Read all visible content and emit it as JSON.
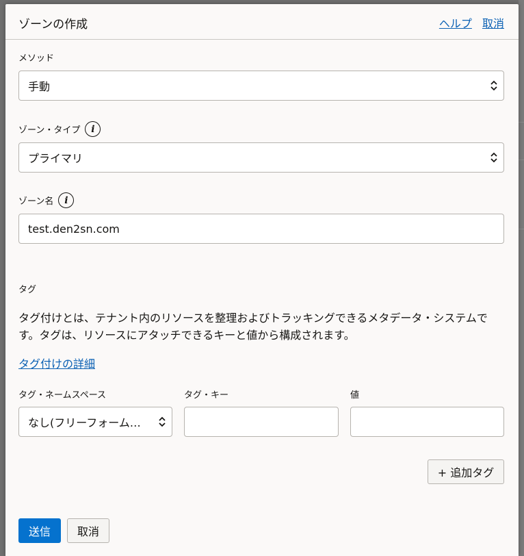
{
  "header": {
    "title": "ゾーンの作成",
    "help_link": "ヘルプ",
    "cancel_link": "取消"
  },
  "method": {
    "label": "メソッド",
    "selected": "手動"
  },
  "zone_type": {
    "label": "ゾーン・タイプ",
    "selected": "プライマリ"
  },
  "zone_name": {
    "label": "ゾーン名",
    "value": "test.den2sn.com"
  },
  "tags": {
    "section_label": "タグ",
    "description": "タグ付けとは、テナント内のリソースを整理およびトラッキングできるメタデータ・システムです。タグは、リソースにアタッチできるキーと値から構成されます。",
    "details_link": "タグ付けの詳細",
    "namespace_label": "タグ・ネームスペース",
    "namespace_selected": "なし(フリーフォーム…",
    "key_label": "タグ・キー",
    "key_value": "",
    "value_label": "値",
    "value_value": "",
    "add_tag_button": "+ 追加タグ"
  },
  "footer": {
    "submit_button": "送信",
    "cancel_button": "取消"
  },
  "colors": {
    "accent": "#0572ce",
    "link": "#0b61b4",
    "panel_bg": "#fbf9f8"
  }
}
